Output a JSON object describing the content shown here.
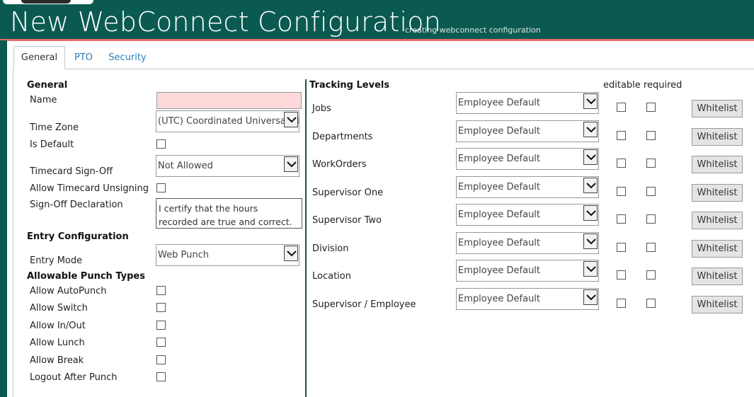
{
  "app": {
    "title": "New WebConnect Configuration",
    "subtitle": "creating webconnect configuration"
  },
  "tabs": [
    {
      "label": "General",
      "active": true
    },
    {
      "label": "PTO",
      "active": false
    },
    {
      "label": "Security",
      "active": false
    }
  ],
  "general": {
    "heading": "General",
    "name_label": "Name",
    "name_value": "",
    "timezone_label": "Time Zone",
    "timezone_value": "(UTC) Coordinated Universal Time",
    "is_default_label": "Is Default",
    "is_default_checked": false,
    "timecard_signoff_label": "Timecard Sign-Off",
    "timecard_signoff_value": "Not Allowed",
    "allow_unsigning_label": "Allow Timecard Unsigning",
    "allow_unsigning_checked": false,
    "signoff_declaration_label": "Sign-Off Declaration",
    "signoff_declaration_value": "I certify that the hours recorded are true and correct."
  },
  "entry": {
    "heading": "Entry Configuration",
    "entry_mode_label": "Entry Mode",
    "entry_mode_value": "Web Punch",
    "punch_types_heading": "Allowable Punch Types",
    "punch_types": [
      {
        "label": "Allow AutoPunch",
        "checked": false
      },
      {
        "label": "Allow Switch",
        "checked": false
      },
      {
        "label": "Allow In/Out",
        "checked": false
      },
      {
        "label": "Allow Lunch",
        "checked": false
      },
      {
        "label": "Allow Break",
        "checked": false
      },
      {
        "label": "Logout After Punch",
        "checked": false
      }
    ]
  },
  "tracking": {
    "heading": "Tracking Levels",
    "col_headers": "editable required",
    "whitelist_label": "Whitelist",
    "rows": [
      {
        "label": "Jobs",
        "value": "Employee Default"
      },
      {
        "label": "Departments",
        "value": "Employee Default"
      },
      {
        "label": "WorkOrders",
        "value": "Employee Default"
      },
      {
        "label": "Supervisor One",
        "value": "Employee Default"
      },
      {
        "label": "Supervisor Two",
        "value": "Employee Default"
      },
      {
        "label": "Division",
        "value": "Employee Default"
      },
      {
        "label": "Location",
        "value": "Employee Default"
      },
      {
        "label": "Supervisor / Employee",
        "value": "Employee Default"
      }
    ]
  },
  "colors": {
    "brand": "#0b5a52",
    "accent_line": "#e66a6a",
    "link": "#2e7fb8",
    "invalid_input": "#ffd9d9"
  }
}
